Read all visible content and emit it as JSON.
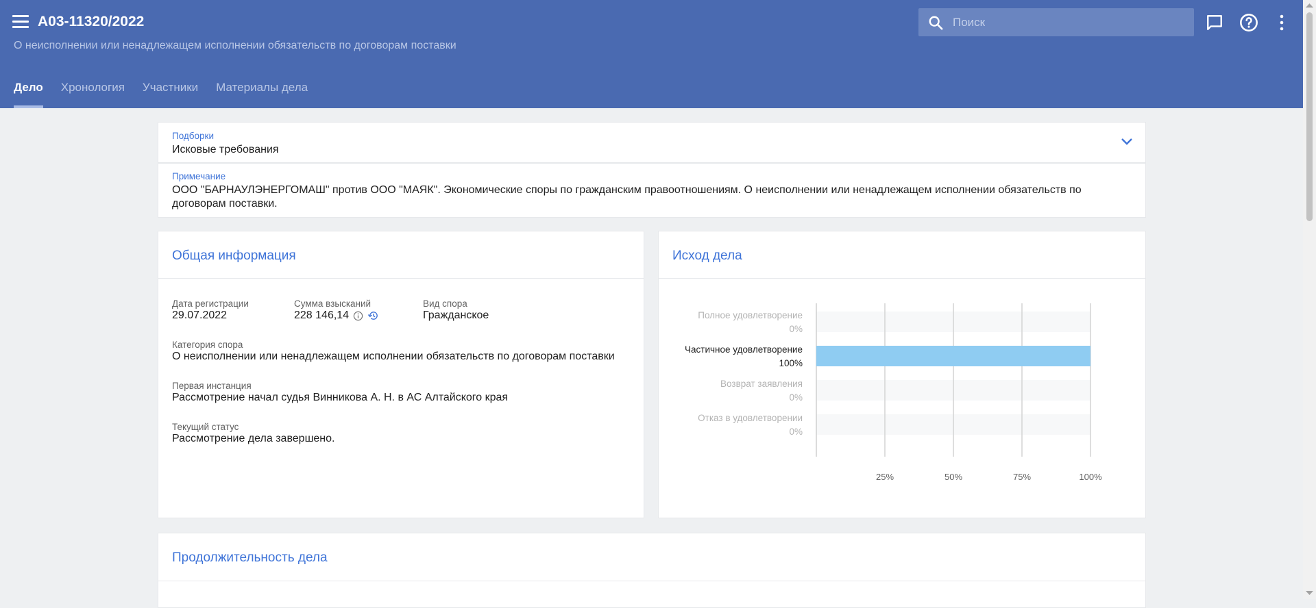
{
  "header": {
    "case_number": "А03-11320/2022",
    "subtitle": "О неисполнении или ненадлежащем исполнении обязательств по договорам поставки",
    "search_placeholder": "Поиск",
    "tabs": [
      "Дело",
      "Хронология",
      "Участники",
      "Материалы дела"
    ],
    "active_tab": "Дело"
  },
  "selections": {
    "label": "Подборки",
    "value": "Исковые требования"
  },
  "note": {
    "label": "Примечание",
    "text": "ООО \"БАРНАУЛЭНЕРГОМАШ\" против ООО \"МАЯК\". Экономические споры по гражданским правоотношениям. О неисполнении или ненадлежащем исполнении обязательств по договорам поставки."
  },
  "general_info": {
    "title": "Общая информация",
    "reg_date_label": "Дата регистрации",
    "reg_date": "29.07.2022",
    "sum_label": "Сумма взысканий",
    "sum": "228 146,14",
    "dispute_type_label": "Вид спора",
    "dispute_type": "Гражданское",
    "category_label": "Категория спора",
    "category": "О неисполнении или ненадлежащем исполнении обязательств по договорам поставки",
    "first_instance_label": "Первая инстанция",
    "first_instance": "Рассмотрение начал судья Винникова А. Н. в АС Алтайского края",
    "status_label": "Текущий статус",
    "status": "Рассмотрение дела завершено."
  },
  "outcome": {
    "title": "Исход дела"
  },
  "chart_data": {
    "type": "bar",
    "orientation": "horizontal",
    "categories": [
      "Полное удовлетворение",
      "Частичное удовлетворение",
      "Возврат заявления",
      "Отказ в удовлетворении"
    ],
    "values": [
      0,
      100,
      0,
      0
    ],
    "value_labels": [
      "0%",
      "100%",
      "0%",
      "0%"
    ],
    "x_ticks": [
      "25%",
      "50%",
      "75%",
      "100%"
    ],
    "xlim": [
      0,
      100
    ],
    "grid": true,
    "bar_color": "#8fccf2"
  },
  "duration": {
    "title": "Продолжительность дела"
  },
  "colors": {
    "header_bg": "#4a6ab1",
    "accent": "#3f74d8"
  }
}
